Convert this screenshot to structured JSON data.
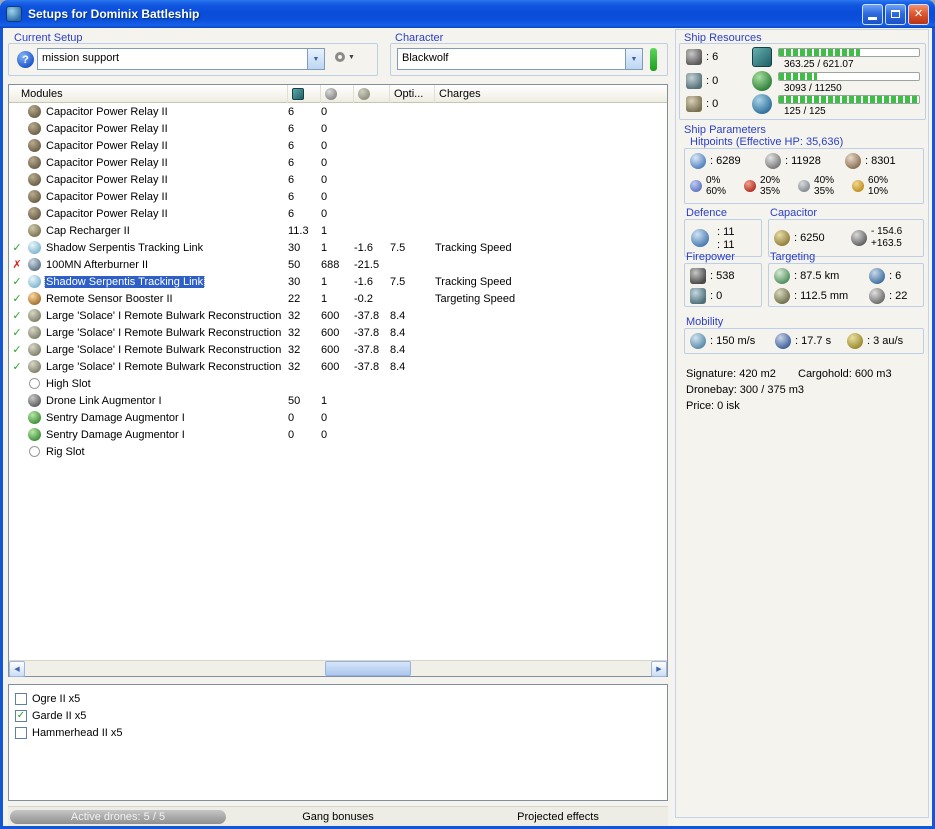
{
  "window": {
    "title": "Setups for Dominix Battleship"
  },
  "setup": {
    "label": "Current Setup",
    "value": "mission support"
  },
  "character": {
    "label": "Character",
    "value": "Blackwolf"
  },
  "table": {
    "header": {
      "modules": "Modules",
      "opti": "Opti...",
      "charges": "Charges"
    },
    "rows": [
      {
        "status": "none",
        "icon": "relay",
        "name": "Capacitor Power Relay II",
        "cpu": "6",
        "pg": "0"
      },
      {
        "status": "none",
        "icon": "relay",
        "name": "Capacitor Power Relay II",
        "cpu": "6",
        "pg": "0"
      },
      {
        "status": "none",
        "icon": "relay",
        "name": "Capacitor Power Relay II",
        "cpu": "6",
        "pg": "0"
      },
      {
        "status": "none",
        "icon": "relay",
        "name": "Capacitor Power Relay II",
        "cpu": "6",
        "pg": "0"
      },
      {
        "status": "none",
        "icon": "relay",
        "name": "Capacitor Power Relay II",
        "cpu": "6",
        "pg": "0"
      },
      {
        "status": "none",
        "icon": "relay",
        "name": "Capacitor Power Relay II",
        "cpu": "6",
        "pg": "0"
      },
      {
        "status": "none",
        "icon": "relay",
        "name": "Capacitor Power Relay II",
        "cpu": "6",
        "pg": "0"
      },
      {
        "status": "none",
        "icon": "recharger",
        "name": "Cap Recharger II",
        "cpu": "11.3",
        "pg": "1"
      },
      {
        "status": "ok",
        "icon": "tracklink",
        "name": "Shadow Serpentis Tracking Link",
        "cpu": "30",
        "pg": "1",
        "cap": "-1.6",
        "opti": "7.5",
        "charges": "Tracking Speed"
      },
      {
        "status": "error",
        "icon": "afterburner",
        "name": "100MN Afterburner II",
        "cpu": "50",
        "pg": "688",
        "cap": "-21.5"
      },
      {
        "status": "ok",
        "sel": true,
        "icon": "tracklink",
        "name": "Shadow Serpentis Tracking Link",
        "cpu": "30",
        "pg": "1",
        "cap": "-1.6",
        "opti": "7.5",
        "charges": "Tracking Speed"
      },
      {
        "status": "ok",
        "icon": "sensorboost",
        "name": "Remote Sensor Booster II",
        "cpu": "22",
        "pg": "1",
        "cap": "-0.2",
        "charges": "Targeting Speed"
      },
      {
        "status": "ok",
        "icon": "bulwark",
        "name": "Large 'Solace' I Remote Bulwark Reconstruction",
        "cpu": "32",
        "pg": "600",
        "cap": "-37.8",
        "opti": "8.4"
      },
      {
        "status": "ok",
        "icon": "bulwark",
        "name": "Large 'Solace' I Remote Bulwark Reconstruction",
        "cpu": "32",
        "pg": "600",
        "cap": "-37.8",
        "opti": "8.4"
      },
      {
        "status": "ok",
        "icon": "bulwark",
        "name": "Large 'Solace' I Remote Bulwark Reconstruction",
        "cpu": "32",
        "pg": "600",
        "cap": "-37.8",
        "opti": "8.4"
      },
      {
        "status": "ok",
        "icon": "bulwark",
        "name": "Large 'Solace' I Remote Bulwark Reconstruction",
        "cpu": "32",
        "pg": "600",
        "cap": "-37.8",
        "opti": "8.4"
      },
      {
        "status": "none",
        "icon": "emptyhigh",
        "name": "High Slot"
      },
      {
        "status": "none",
        "icon": "dronelink",
        "name": "Drone Link Augmentor I",
        "cpu": "50",
        "pg": "1"
      },
      {
        "status": "none",
        "icon": "sentryaug",
        "name": "Sentry Damage Augmentor I",
        "cpu": "0",
        "pg": "0"
      },
      {
        "status": "none",
        "icon": "sentryaug",
        "name": "Sentry Damage Augmentor I",
        "cpu": "0",
        "pg": "0"
      },
      {
        "status": "none",
        "icon": "emptyrig",
        "name": "Rig Slot"
      }
    ]
  },
  "drones": {
    "items": [
      {
        "checked": false,
        "label": "Ogre II x5"
      },
      {
        "checked": true,
        "label": "Garde II x5"
      },
      {
        "checked": false,
        "label": "Hammerhead II x5"
      }
    ]
  },
  "footer": {
    "active_drones": "Active drones: 5 / 5",
    "gang": "Gang bonuses",
    "projected": "Projected effects"
  },
  "sr": {
    "label": "Ship Resources",
    "turrets": ": 6",
    "launchers": ": 0",
    "rigs": ": 0",
    "cpu_text": "363.25 / 621.07",
    "cpu_pct": 58,
    "pg_text": "3093 / 11250",
    "pg_pct": 27,
    "bw_text": "125 / 125",
    "bw_pct": 100
  },
  "sp": {
    "label": "Ship Parameters",
    "hp": {
      "label": "Hitpoints (Effective HP: 35,636)",
      "shield": ": 6289",
      "armor": ": 11928",
      "hull": ": 8301",
      "resists": [
        {
          "type": "em",
          "shield": "0%",
          "armor": "60%"
        },
        {
          "type": "thermal",
          "shield": "20%",
          "armor": "35%"
        },
        {
          "type": "kinetic",
          "shield": "40%",
          "armor": "35%"
        },
        {
          "type": "explosive",
          "shield": "60%",
          "armor": "10%"
        }
      ]
    },
    "defence": {
      "label": "Defence",
      "v1": ": 11",
      "v2": ": 11"
    },
    "capacitor": {
      "label": "Capacitor",
      "amount": ": 6250",
      "drain": "- 154.6",
      "recharge": "+163.5"
    },
    "firepower": {
      "label": "Firepower",
      "turret": ": 538",
      "missile": ": 0"
    },
    "targeting": {
      "label": "Targeting",
      "range": ": 87.5 km",
      "locks": ": 6",
      "scanres": ": 112.5 mm",
      "sensor": ": 22"
    },
    "mobility": {
      "label": "Mobility",
      "speed": ": 150 m/s",
      "align": ": 17.7 s",
      "warp": ": 3 au/s"
    },
    "signature": "Signature: 420 m2",
    "cargohold": "Cargohold: 600 m3",
    "dronebay": "Dronebay: 300 / 375 m3",
    "price": "Price: 0 isk"
  }
}
